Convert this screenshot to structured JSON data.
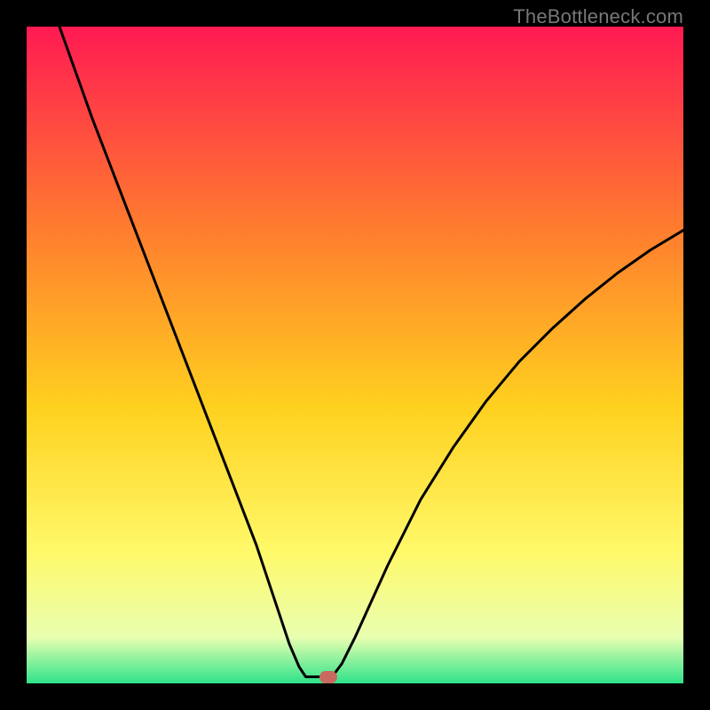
{
  "watermark": "TheBottleneck.com",
  "chart_data": {
    "type": "line",
    "title": "",
    "xlabel": "",
    "ylabel": "",
    "xlim": [
      0,
      100
    ],
    "ylim": [
      0,
      100
    ],
    "grid": false,
    "background_gradient": {
      "top": "#ff1a52",
      "mid1": "#ff7a2f",
      "mid2": "#ffd11f",
      "mid3": "#fff96a",
      "mid4": "#e8ffb0",
      "bottom": "#2fe38a"
    },
    "series": [
      {
        "name": "bottleneck-curve-left",
        "x": [
          5,
          10,
          15,
          20,
          25,
          30,
          35,
          38,
          40,
          41.5,
          42.5
        ],
        "y": [
          100,
          86,
          73,
          60,
          47,
          34,
          21,
          12,
          6,
          2.5,
          1
        ]
      },
      {
        "name": "bottleneck-plateau",
        "x": [
          42.5,
          45,
          46.5
        ],
        "y": [
          1,
          1,
          1
        ]
      },
      {
        "name": "bottleneck-curve-right",
        "x": [
          46.5,
          48,
          50,
          55,
          60,
          65,
          70,
          75,
          80,
          85,
          90,
          95,
          100
        ],
        "y": [
          1,
          3,
          7,
          18,
          28,
          36,
          43,
          49,
          54,
          58.5,
          62.5,
          66,
          69
        ]
      }
    ],
    "marker": {
      "x": 46,
      "y": 1,
      "color": "#c96a5e"
    }
  }
}
